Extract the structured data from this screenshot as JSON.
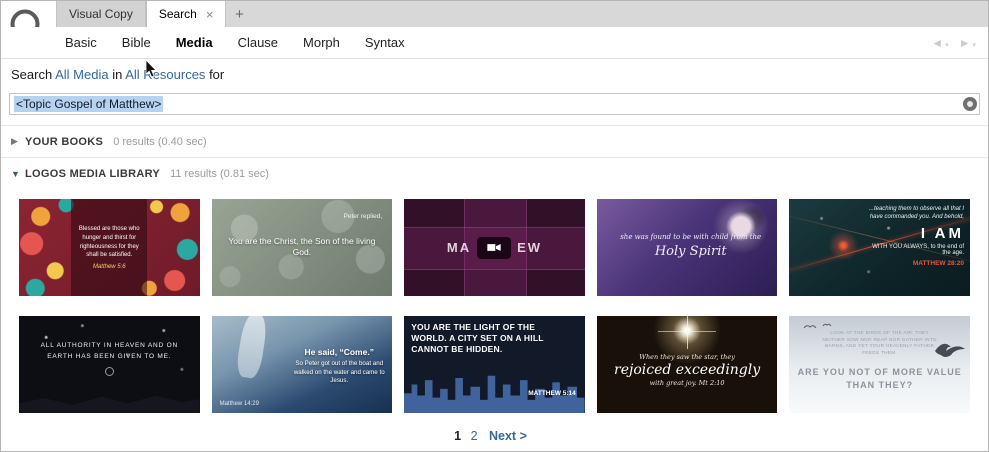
{
  "tabs": {
    "items": [
      {
        "label": "Visual Copy"
      },
      {
        "label": "Search"
      }
    ],
    "close_glyph": "×",
    "new_tab": "+"
  },
  "subnav": {
    "items": [
      "Basic",
      "Bible",
      "Media",
      "Clause",
      "Morph",
      "Syntax"
    ],
    "active": "Media"
  },
  "search": {
    "prefix": "Search",
    "media_link": "All Media",
    "in_word": "in",
    "resources_link": "All Resources",
    "for_word": "for",
    "query": "<Topic Gospel of Matthew>"
  },
  "sections": {
    "your_books": {
      "arrow": "▶",
      "title": "YOUR BOOKS",
      "results": "0 results (0.40 sec)"
    },
    "media_library": {
      "arrow": "▼",
      "title": "LOGOS MEDIA LIBRARY",
      "results": "11 results (0.81 sec)"
    }
  },
  "thumbs": [
    {
      "caption": "Blessed are those who hunger and thirst for righteousness for they shall be satisfied.",
      "ref": "Matthew 5:6"
    },
    {
      "top": "Peter replied,",
      "caption": "You are the Christ, the Son of the living God."
    },
    {
      "left": "MA",
      "right": "EW"
    },
    {
      "lines": "she was found to be with child from the",
      "big": "Holy Spirit"
    },
    {
      "top": "...teaching them to observe all that I have commanded you. And behold,",
      "big": "I AM",
      "mid": "WITH YOU ALWAYS, to the end of the age.",
      "ref": "MATTHEW 28:20"
    },
    {
      "caption": "ALL AUTHORITY IN HEAVEN AND ON EARTH HAS BEEN GIVEN TO ME."
    },
    {
      "big": "He said, “Come.”",
      "caption": "So Peter got out of the boat and walked on the water and came to Jesus.",
      "ref": "Matthew 14:29"
    },
    {
      "caption": "YOU ARE THE LIGHT OF THE WORLD. A CITY SET ON A HILL CANNOT BE HIDDEN.",
      "ref": "MATTHEW 5:14"
    },
    {
      "line1": "When they saw the star, they",
      "line2": "rejoiced exceedingly",
      "line3": "with great joy. Mt 2:10"
    },
    {
      "top": "LOOK AT THE BIRDS OF THE AIR: THEY NEITHER SOW NOR REAP NOR GATHER INTO BARNS, AND YET YOUR HEAVENLY FATHER FEEDS THEM.",
      "caption": "ARE YOU NOT OF MORE VALUE THAN THEY?"
    }
  ],
  "pagination": {
    "page1": "1",
    "page2": "2",
    "next": "Next >"
  },
  "colors": {
    "link": "#34699a",
    "selection": "#b5d3ee",
    "tabstrip": "#d8d8d8"
  }
}
